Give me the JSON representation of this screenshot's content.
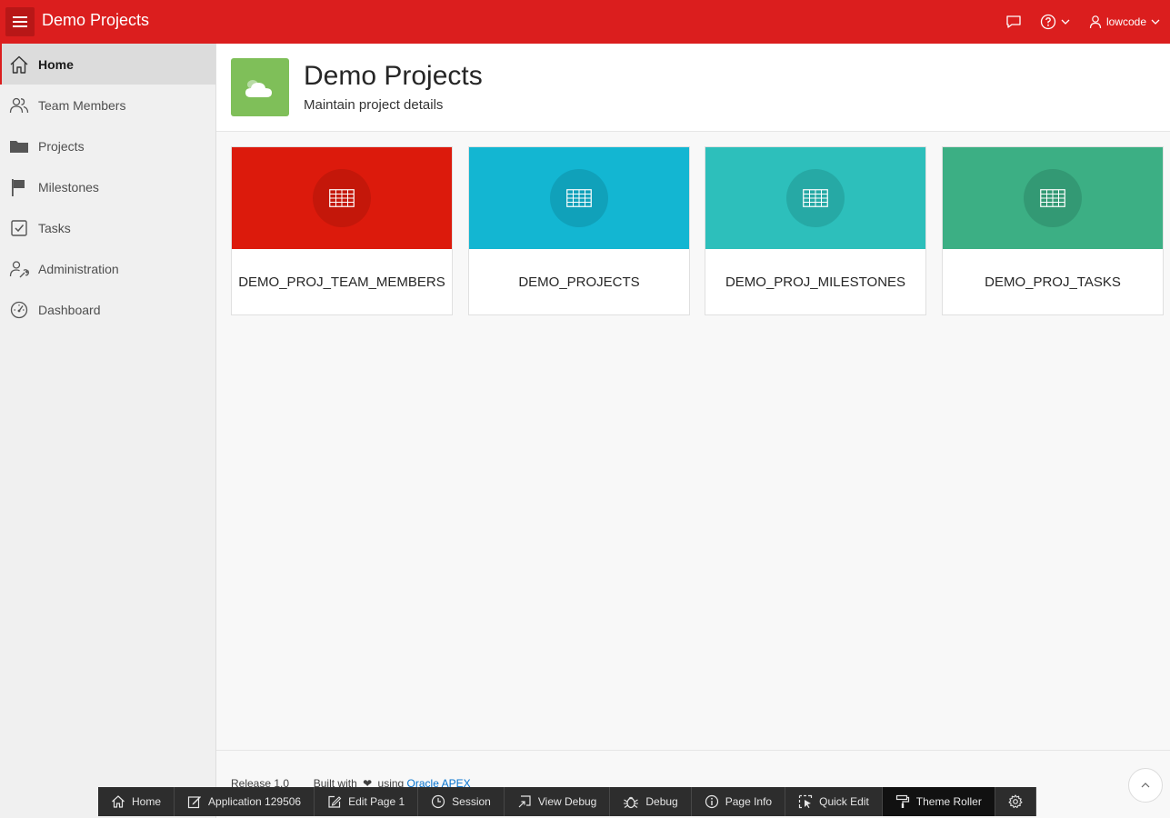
{
  "header": {
    "title": "Demo Projects",
    "user": "lowcode",
    "color": "#db1e1e"
  },
  "sidebar": {
    "items": [
      {
        "label": "Home",
        "icon": "home-icon",
        "active": true
      },
      {
        "label": "Team Members",
        "icon": "users-icon"
      },
      {
        "label": "Projects",
        "icon": "folder-icon"
      },
      {
        "label": "Milestones",
        "icon": "flag-icon"
      },
      {
        "label": "Tasks",
        "icon": "check-square-icon"
      },
      {
        "label": "Administration",
        "icon": "user-wrench-icon"
      },
      {
        "label": "Dashboard",
        "icon": "gauge-icon"
      }
    ]
  },
  "hero": {
    "title": "Demo Projects",
    "subtitle": "Maintain project details",
    "icon": "cloud-icon",
    "icon_color": "#7fbf59"
  },
  "cards": [
    {
      "label": "DEMO_PROJ_TEAM_MEMBERS",
      "color": "#dc1a0c",
      "circle": "#c4170a",
      "icon": "table-icon"
    },
    {
      "label": "DEMO_PROJECTS",
      "color": "#13b6d2",
      "circle": "#10a1ba",
      "icon": "table-icon"
    },
    {
      "label": "DEMO_PROJ_MILESTONES",
      "color": "#2dbfbb",
      "circle": "#26a9a5",
      "icon": "table-icon"
    },
    {
      "label": "DEMO_PROJ_TASKS",
      "color": "#3caf84",
      "circle": "#339974",
      "icon": "table-icon"
    }
  ],
  "footer": {
    "release": "Release 1.0",
    "built_with": "Built with",
    "using": "using",
    "link": "Oracle APEX"
  },
  "devbar": {
    "items": [
      {
        "label": "Home",
        "icon": "home-icon"
      },
      {
        "label": "Application 129506",
        "icon": "edit-app-icon"
      },
      {
        "label": "Edit Page 1",
        "icon": "edit-page-icon"
      },
      {
        "label": "Session",
        "icon": "clock-icon"
      },
      {
        "label": "View Debug",
        "icon": "view-debug-icon"
      },
      {
        "label": "Debug",
        "icon": "bug-icon"
      },
      {
        "label": "Page Info",
        "icon": "info-icon"
      },
      {
        "label": "Quick Edit",
        "icon": "quick-edit-icon"
      },
      {
        "label": "Theme Roller",
        "icon": "paint-roller-icon"
      }
    ]
  }
}
